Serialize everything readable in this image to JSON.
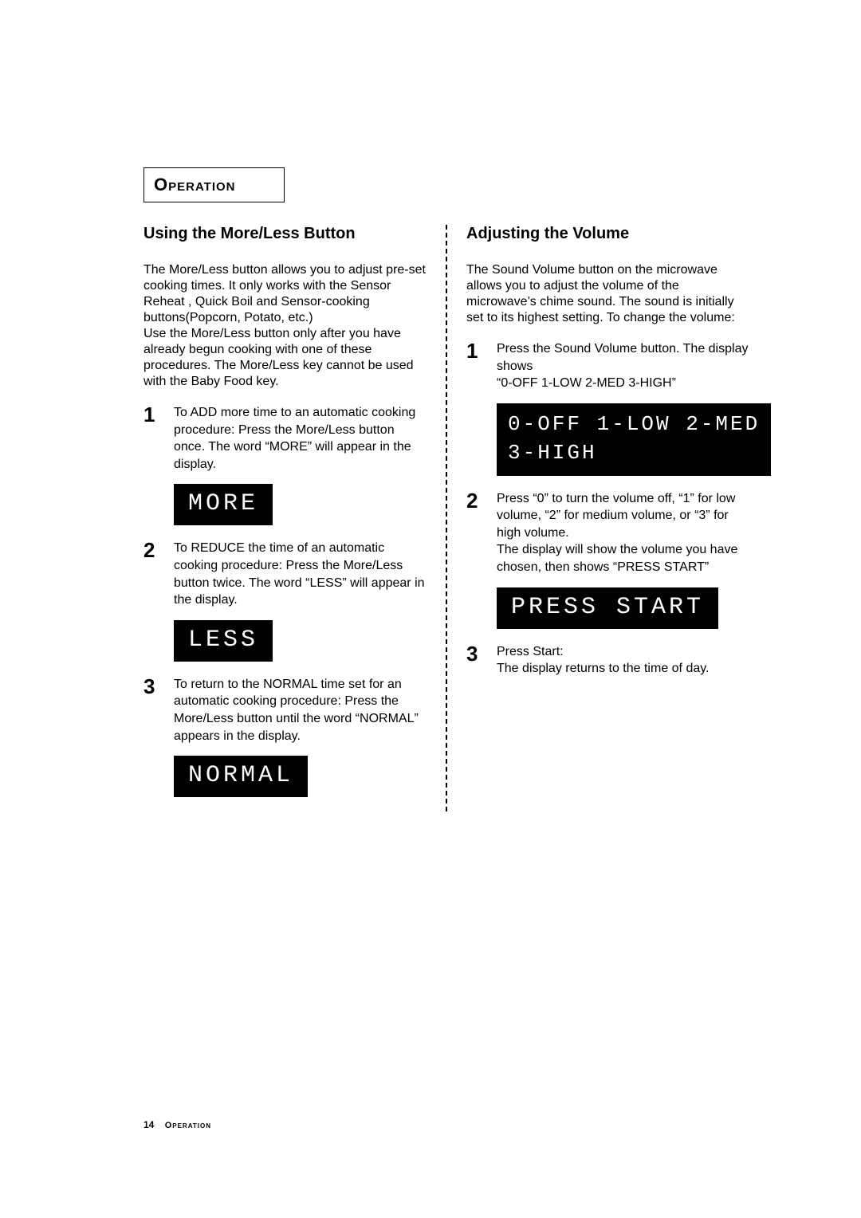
{
  "section_title": "Operation",
  "left": {
    "heading": "Using the More/Less Button",
    "intro": "The More/Less button allows you to adjust pre-set cooking times. It only works with the Sensor Reheat , Quick Boil and Sensor-cooking buttons(Popcorn, Potato, etc.)\nUse the More/Less button only after you have already begun cooking with one of these procedures. The More/Less key cannot be used with the Baby Food key.",
    "steps": [
      {
        "num": "1",
        "text": "To ADD more time to an automatic cooking procedure:  Press the More/Less button once. The word “MORE”  will appear in the display.",
        "lcd": "MORE"
      },
      {
        "num": "2",
        "text": "To REDUCE the time of an automatic cooking procedure:  Press the More/Less button twice. The word “LESS” will appear in the display.",
        "lcd": "LESS"
      },
      {
        "num": "3",
        "text": "To return to the NORMAL time set for an automatic cooking procedure:  Press the More/Less button until the word “NORMAL” appears in the display.",
        "lcd": "NORMAL"
      }
    ]
  },
  "right": {
    "heading": "Adjusting the Volume",
    "intro": "The Sound Volume button on the microwave allows you to adjust the volume of the microwave’s chime sound. The sound is initially set to its highest setting. To change the volume:",
    "steps": [
      {
        "num": "1",
        "text": "Press the Sound Volume button. The display shows\n“0-OFF 1-LOW 2-MED 3-HIGH”",
        "lcd": "0-OFF 1-LOW 2-MED\n3-HIGH",
        "multi": true
      },
      {
        "num": "2",
        "text": "Press “0” to turn the volume off, “1” for low volume, “2” for medium volume, or “3” for high volume.\nThe display will show the volume you have chosen, then shows “PRESS START”",
        "lcd": "PRESS START"
      },
      {
        "num": "3",
        "text": "Press Start:\nThe display returns to the time of day.",
        "lcd": null
      }
    ]
  },
  "footer": {
    "page_number": "14",
    "section": "Operation"
  }
}
